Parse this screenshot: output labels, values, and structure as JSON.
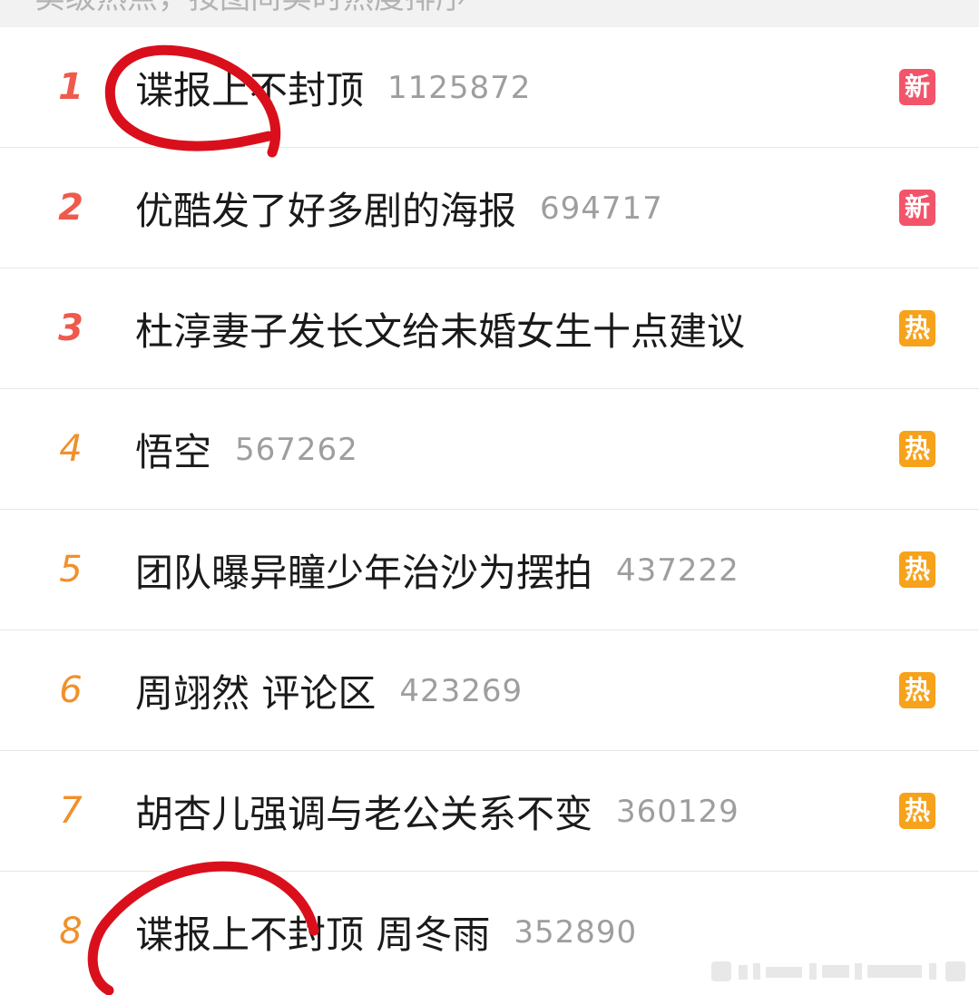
{
  "header": {
    "partial_text": "实级热点，按图间实时热度排序"
  },
  "items": [
    {
      "rank": "1",
      "title": "谍报上不封顶",
      "heat": "1125872",
      "badge": "新",
      "badge_type": "new",
      "rank_style": "top"
    },
    {
      "rank": "2",
      "title": "优酷发了好多剧的海报",
      "heat": "694717",
      "badge": "新",
      "badge_type": "new",
      "rank_style": "top"
    },
    {
      "rank": "3",
      "title": "杜淳妻子发长文给未婚女生十点建议",
      "heat": "",
      "badge": "热",
      "badge_type": "hot",
      "rank_style": "top"
    },
    {
      "rank": "4",
      "title": "悟空",
      "heat": "567262",
      "badge": "热",
      "badge_type": "hot",
      "rank_style": "mid"
    },
    {
      "rank": "5",
      "title": "团队曝异瞳少年治沙为摆拍",
      "heat": "437222",
      "badge": "热",
      "badge_type": "hot",
      "rank_style": "mid"
    },
    {
      "rank": "6",
      "title": "周翊然 评论区",
      "heat": "423269",
      "badge": "热",
      "badge_type": "hot",
      "rank_style": "mid"
    },
    {
      "rank": "7",
      "title": "胡杏儿强调与老公关系不变",
      "heat": "360129",
      "badge": "热",
      "badge_type": "hot",
      "rank_style": "mid"
    },
    {
      "rank": "8",
      "title": "谍报上不封顶 周冬雨",
      "heat": "352890",
      "badge": "",
      "badge_type": "none",
      "rank_style": "mid"
    }
  ],
  "colors": {
    "rank_top": "#ef5a4d",
    "rank_mid": "#f0902b",
    "badge_new": "#f2546a",
    "badge_hot": "#f7a21b",
    "annotation_red": "#d9101c"
  }
}
